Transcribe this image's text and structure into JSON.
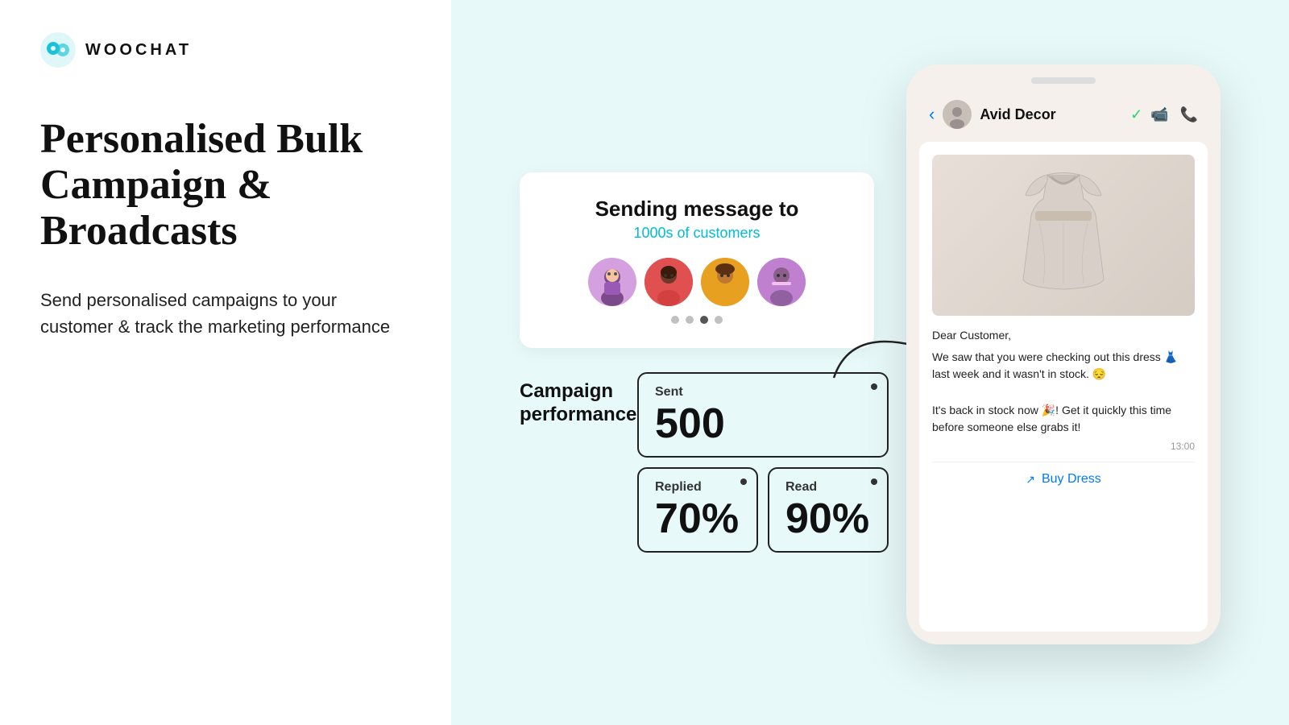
{
  "logo": {
    "text": "WOOCHAT"
  },
  "left": {
    "heading": "Personalised Bulk Campaign & Broadcasts",
    "subtext": "Send personalised campaigns to your customer & track the marketing performance"
  },
  "sending": {
    "title": "Sending message to",
    "subtitle": "1000s of customers",
    "avatars": [
      "👩",
      "👩🏾",
      "👨🏾",
      "👩🏾"
    ],
    "dots": [
      false,
      false,
      true,
      false
    ]
  },
  "campaign": {
    "label": "Campaign performance",
    "stats": [
      {
        "label": "Sent",
        "value": "500"
      },
      {
        "label": "Replied",
        "value": "70%"
      },
      {
        "label": "Read",
        "value": "90%"
      }
    ]
  },
  "phone": {
    "contact_name": "Avid Decor",
    "message_greeting": "Dear Customer,",
    "message_body1": "We saw that you were checking out this dress 👗 last week and it wasn't in stock. 😔",
    "message_body2": "It's back in stock now 🎉! Get it quickly this time before someone else grabs it!",
    "message_time": "13:00",
    "buy_button": "Buy Dress"
  }
}
